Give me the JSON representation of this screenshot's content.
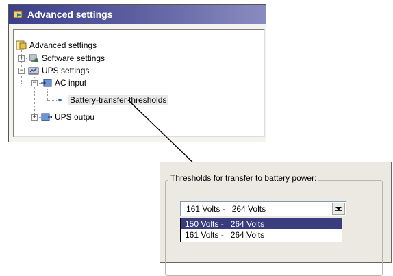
{
  "window": {
    "title": "Advanced settings"
  },
  "tree": {
    "root": "Advanced settings",
    "software": "Software settings",
    "ups": "UPS settings",
    "ac_input": "AC input",
    "battery": "Battery-transfer thresholds",
    "ups_output": "UPS outpu"
  },
  "panel": {
    "group_label": "Thresholds for transfer to battery power:",
    "selected_value": "161 Volts -   264 Volts",
    "options": [
      "150 Volts -   264 Volts",
      "161 Volts -   264 Volts"
    ]
  },
  "colors": {
    "title_gradient_start": "#3b3f8c",
    "highlight": "#3a3d7d"
  }
}
